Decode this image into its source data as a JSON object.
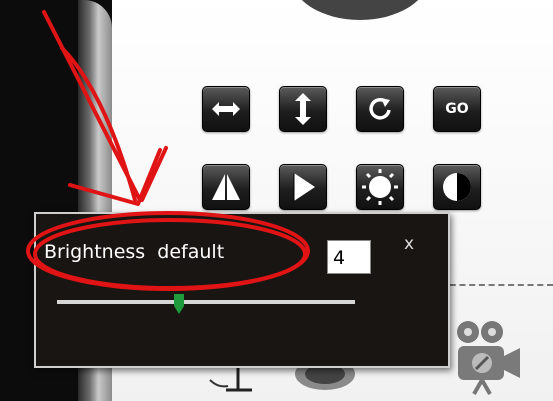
{
  "toolbar": {
    "row1": [
      {
        "name": "flip-horizontal-button",
        "icon": "horizontal-arrows-icon"
      },
      {
        "name": "flip-vertical-button",
        "icon": "vertical-arrows-icon"
      },
      {
        "name": "refresh-button",
        "icon": "refresh-icon"
      },
      {
        "name": "go-button",
        "label": "GO"
      }
    ],
    "row2": [
      {
        "name": "mirror-button",
        "icon": "mirror-triangle-icon"
      },
      {
        "name": "flip-right-button",
        "icon": "half-triangle-icon"
      },
      {
        "name": "brightness-button",
        "icon": "sun-icon"
      },
      {
        "name": "contrast-button",
        "icon": "contrast-icon"
      }
    ],
    "go_label": "GO"
  },
  "popup": {
    "label": "Brightness  default",
    "value": "4",
    "close_label": "x",
    "slider_level": 0.41,
    "slider_color": "#1f9a3c"
  },
  "bottom_icons": [
    "tripod-icon",
    "lens-icon",
    "camera-icon"
  ],
  "colors": {
    "annotation": "#e01414",
    "popup_bg": "#191512",
    "toolbar_button": "#1e1e1e"
  }
}
